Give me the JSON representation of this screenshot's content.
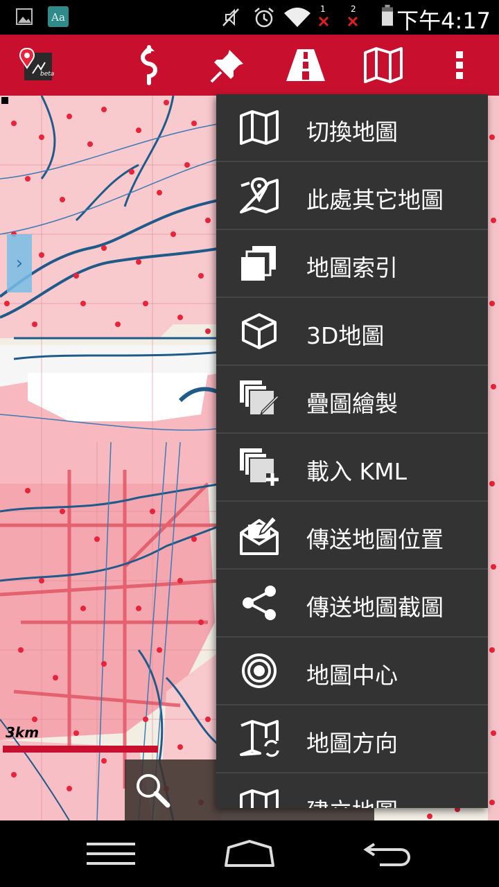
{
  "status_bar": {
    "time": "下午4:17",
    "sim1_label": "1",
    "sim2_label": "2",
    "icons": [
      "gallery-icon",
      "dictionary-app-icon",
      "mute-icon",
      "alarm-icon",
      "wifi-icon",
      "no-signal-icon",
      "no-signal-icon",
      "battery-icon"
    ]
  },
  "action_bar": {
    "logo_caption": "beta",
    "actions": [
      "route-icon",
      "pin-icon",
      "road-icon",
      "map-icon",
      "overflow-menu-icon"
    ]
  },
  "map": {
    "scale_label": "3km",
    "side_tab_glyph": "›",
    "colors": {
      "urban": "#f5a7b0",
      "water": "#1e5a8a",
      "poi": "#e8233a",
      "accent": "#c8102e"
    }
  },
  "menu": {
    "items": [
      {
        "label": "切換地圖",
        "icon": "map-icon"
      },
      {
        "label": "此處其它地圖",
        "icon": "map-marker-icon"
      },
      {
        "label": "地圖索引",
        "icon": "layers-icon"
      },
      {
        "label": "3D地圖",
        "icon": "cube-icon"
      },
      {
        "label": "疊圖繪製",
        "icon": "layers-edit-icon"
      },
      {
        "label": "載入 KML",
        "icon": "layers-add-icon"
      },
      {
        "label": "傳送地圖位置",
        "icon": "mail-icon"
      },
      {
        "label": "傳送地圖截圖",
        "icon": "share-icon"
      },
      {
        "label": "地圖中心",
        "icon": "target-icon"
      },
      {
        "label": "地圖方向",
        "icon": "map-rotate-icon"
      },
      {
        "label": "建立地圖",
        "icon": "map-icon"
      }
    ]
  },
  "nav_bar": {
    "buttons": [
      "menu-icon",
      "home-icon",
      "back-icon"
    ]
  }
}
